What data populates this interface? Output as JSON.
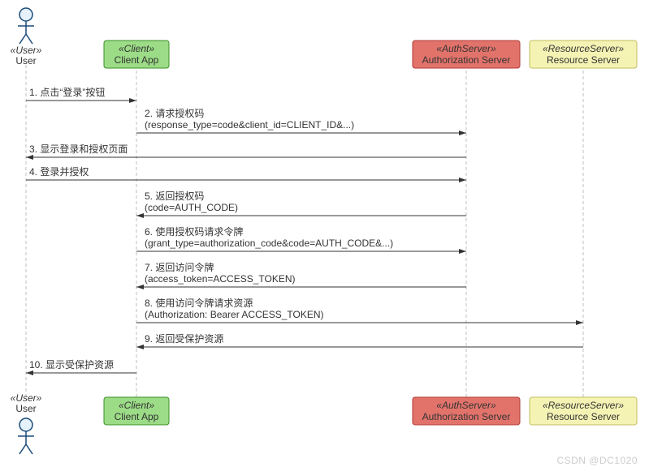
{
  "participants": {
    "user": {
      "stereo": "«User»",
      "name": "User"
    },
    "client": {
      "stereo": "«Client»",
      "name": "Client App"
    },
    "auth": {
      "stereo": "«AuthServer»",
      "name": "Authorization Server"
    },
    "resource": {
      "stereo": "«ResourceServer»",
      "name": "Resource Server"
    }
  },
  "messages": {
    "m1": {
      "line1": "1. 点击“登录”按钮"
    },
    "m2": {
      "line1": "2. 请求授权码",
      "line2": "(response_type=code&client_id=CLIENT_ID&...)"
    },
    "m3": {
      "line1": "3. 显示登录和授权页面"
    },
    "m4": {
      "line1": "4. 登录并授权"
    },
    "m5": {
      "line1": "5. 返回授权码",
      "line2": "(code=AUTH_CODE)"
    },
    "m6": {
      "line1": "6. 使用授权码请求令牌",
      "line2": "(grant_type=authorization_code&code=AUTH_CODE&...)"
    },
    "m7": {
      "line1": "7. 返回访问令牌",
      "line2": "(access_token=ACCESS_TOKEN)"
    },
    "m8": {
      "line1": "8. 使用访问令牌请求资源",
      "line2": "(Authorization: Bearer ACCESS_TOKEN)"
    },
    "m9": {
      "line1": "9. 返回受保护资源"
    },
    "m10": {
      "line1": "10. 显示受保护资源"
    }
  },
  "colors": {
    "client_fill": "#9cdc87",
    "client_stroke": "#3a8f26",
    "auth_fill": "#e2736b",
    "auth_stroke": "#b13a34",
    "resource_fill": "#f5f3b4",
    "resource_stroke": "#c2be5e",
    "user_stroke": "#1a4b7a",
    "user_fill": "#e6f2fb",
    "line_gray": "#bfbfbf",
    "text": "#333"
  },
  "watermark": "CSDN @DC1020"
}
